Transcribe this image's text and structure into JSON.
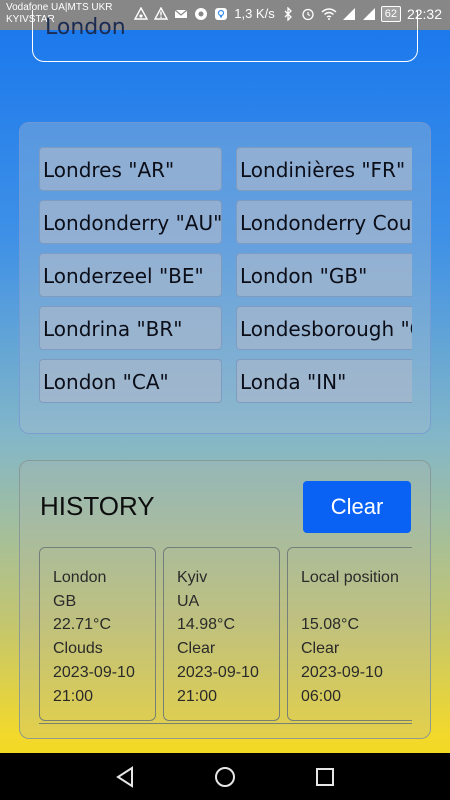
{
  "status_bar": {
    "carrier_line1": "Vodafone UA|MTS UKR",
    "carrier_line2": "KYIVSTAR",
    "speed": "1,3 K/s",
    "net_3g": "3G",
    "net_4g": "4G",
    "battery": "62",
    "time": "22:32"
  },
  "search": {
    "value": "London"
  },
  "suggestions": {
    "items": [
      {
        "label": "Londres \"AR\""
      },
      {
        "label": "Londinières \"FR\""
      },
      {
        "label": "Londonderry \"AU\""
      },
      {
        "label": "Londonderry County"
      },
      {
        "label": "Londerzeel \"BE\""
      },
      {
        "label": "London \"GB\""
      },
      {
        "label": "Londrina \"BR\""
      },
      {
        "label": "Londesborough \"GB\""
      },
      {
        "label": "London \"CA\""
      },
      {
        "label": "Londa \"IN\""
      }
    ]
  },
  "history": {
    "title": "HISTORY",
    "clear_label": "Clear",
    "cards": [
      {
        "name": "London",
        "country": "GB",
        "temp": "22.71°C",
        "weather": "Clouds",
        "date": "2023-09-10",
        "time": "21:00"
      },
      {
        "name": "Kyiv",
        "country": "UA",
        "temp": "14.98°C",
        "weather": "Clear",
        "date": "2023-09-10",
        "time": "21:00"
      },
      {
        "name": "Local position",
        "country": "",
        "temp": "15.08°C",
        "weather": "Clear",
        "date": "2023-09-10",
        "time": "06:00"
      }
    ]
  },
  "colors": {
    "accent": "#0a62f5",
    "gradient_top": "#1776ee",
    "gradient_bottom": "#f5d915"
  },
  "icons": {
    "nav_back": "back-icon",
    "nav_home": "home-icon",
    "nav_recents": "recents-icon"
  }
}
